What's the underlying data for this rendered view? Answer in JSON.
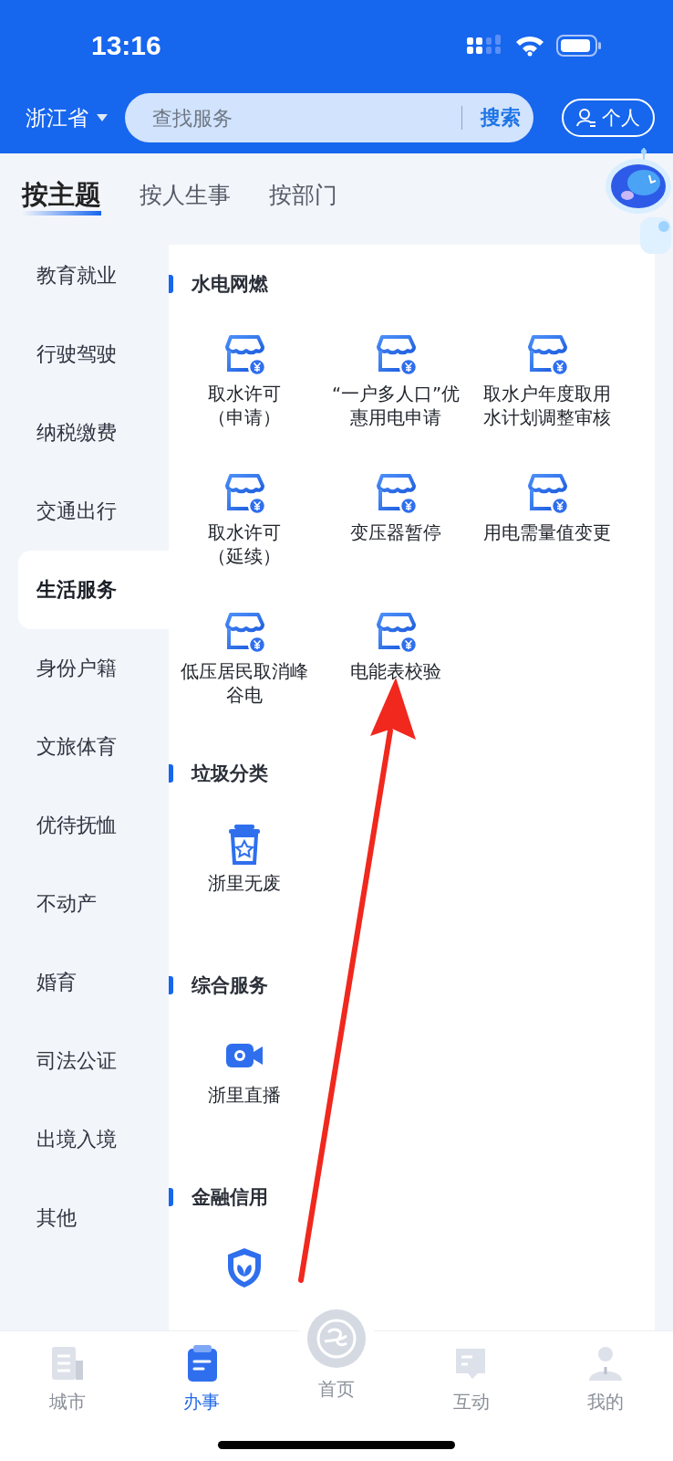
{
  "status_bar": {
    "time": "13:16"
  },
  "header": {
    "region": "浙江省",
    "search": {
      "placeholder": "查找服务",
      "button": "搜索"
    },
    "personal_button": "个人"
  },
  "tabs": [
    {
      "label": "按主题",
      "selected": true
    },
    {
      "label": "按人生事",
      "selected": false
    },
    {
      "label": "按部门",
      "selected": false
    }
  ],
  "sidebar": {
    "items": [
      {
        "label": "教育就业",
        "selected": false
      },
      {
        "label": "行驶驾驶",
        "selected": false
      },
      {
        "label": "纳税缴费",
        "selected": false
      },
      {
        "label": "交通出行",
        "selected": false
      },
      {
        "label": "生活服务",
        "selected": true
      },
      {
        "label": "身份户籍",
        "selected": false
      },
      {
        "label": "文旅体育",
        "selected": false
      },
      {
        "label": "优待抚恤",
        "selected": false
      },
      {
        "label": "不动产",
        "selected": false
      },
      {
        "label": "婚育",
        "selected": false
      },
      {
        "label": "司法公证",
        "selected": false
      },
      {
        "label": "出境入境",
        "selected": false
      },
      {
        "label": "其他",
        "selected": false
      }
    ]
  },
  "sections": [
    {
      "title": "水电网燃",
      "items": [
        {
          "label": "取水许可（申请）",
          "kind": "store"
        },
        {
          "label": "“一户多人口”优惠用电申请",
          "kind": "store"
        },
        {
          "label": "取水户年度取用水计划调整审核",
          "kind": "store"
        },
        {
          "label": "取水许可（延续）",
          "kind": "store"
        },
        {
          "label": "变压器暂停",
          "kind": "store"
        },
        {
          "label": "用电需量值变更",
          "kind": "store"
        },
        {
          "label": "低压居民取消峰谷电",
          "kind": "store"
        },
        {
          "label": "电能表校验",
          "kind": "store"
        }
      ]
    },
    {
      "title": "垃圾分类",
      "items": [
        {
          "label": "浙里无废",
          "kind": "bin"
        }
      ]
    },
    {
      "title": "综合服务",
      "items": [
        {
          "label": "浙里直播",
          "kind": "camera"
        }
      ]
    },
    {
      "title": "金融信用",
      "items": [
        {
          "kind": "shield"
        }
      ]
    }
  ],
  "bottom_nav": [
    {
      "label": "城市",
      "kind": "building",
      "selected": false
    },
    {
      "label": "办事",
      "kind": "clipboard",
      "selected": true
    },
    {
      "label": "首页",
      "kind": "home",
      "selected": false
    },
    {
      "label": "互动",
      "kind": "chat",
      "selected": false
    },
    {
      "label": "我的",
      "kind": "person",
      "selected": false
    }
  ]
}
